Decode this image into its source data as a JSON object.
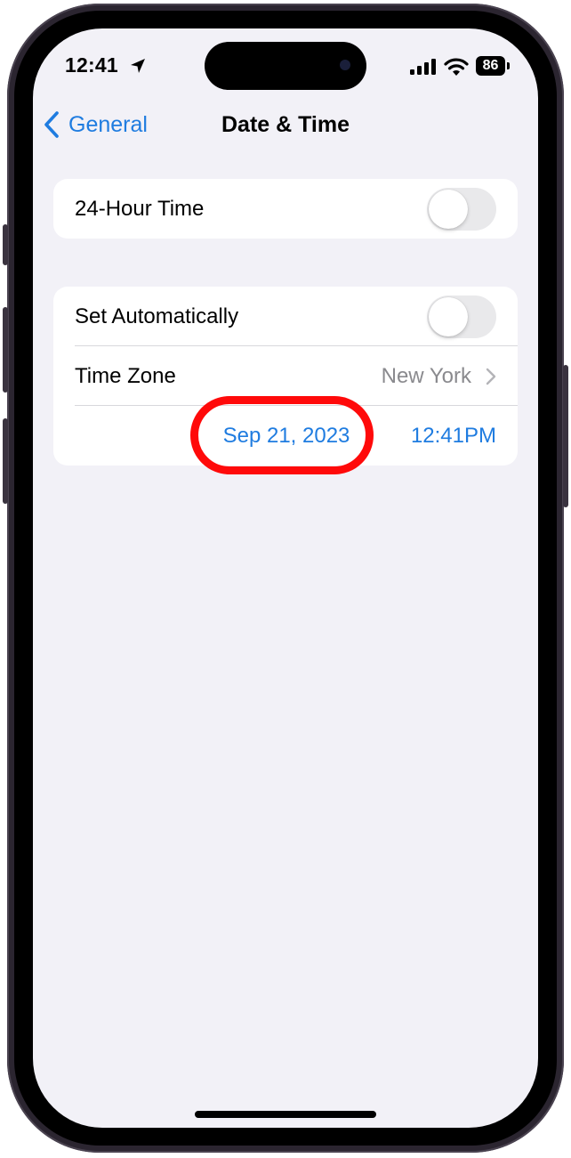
{
  "status_bar": {
    "time": "12:41",
    "battery_level": "86",
    "icons": [
      "location-arrow-icon",
      "cellular-signal-icon",
      "wifi-icon",
      "battery-icon"
    ]
  },
  "nav": {
    "back_label": "General",
    "title": "Date & Time"
  },
  "settings": {
    "hour24": {
      "label": "24-Hour Time",
      "enabled": false
    },
    "set_automatically": {
      "label": "Set Automatically",
      "enabled": false
    },
    "time_zone": {
      "label": "Time Zone",
      "value": "New York"
    },
    "date": "Sep 21, 2023",
    "time": "12:41PM"
  },
  "colors": {
    "accent": "#1f7ce0",
    "background": "#f2f1f7",
    "highlight": "#ff0a0a",
    "toggle_off": "#e9e9eb"
  }
}
